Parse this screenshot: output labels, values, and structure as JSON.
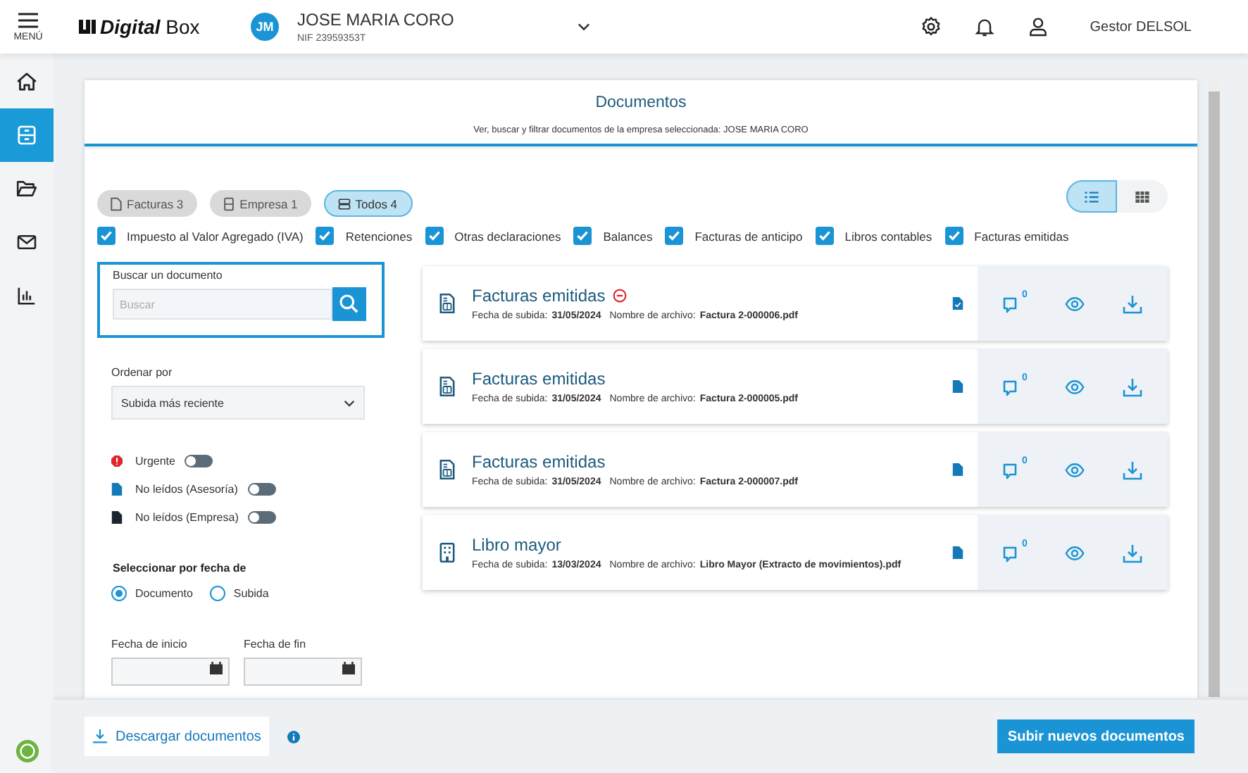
{
  "header": {
    "menu_label": "MENÚ",
    "logo": {
      "bold": "Digital",
      "regular": "Box"
    },
    "company": {
      "initials": "JM",
      "name": "JOSE MARIA CORO",
      "nif": "NIF 23959353T"
    },
    "user": "Gestor DELSOL"
  },
  "sidebar": {
    "items": [
      {
        "selected": false
      },
      {
        "selected": true
      },
      {
        "selected": false
      },
      {
        "selected": false
      },
      {
        "selected": false
      }
    ]
  },
  "page": {
    "title": "Documentos",
    "subtitle": "Ver, buscar y filtrar documentos de la empresa seleccionada: JOSE MARIA CORO"
  },
  "chips": [
    {
      "label": "Facturas 3",
      "selected": false
    },
    {
      "label": "Empresa 1",
      "selected": false
    },
    {
      "label": "Todos 4",
      "selected": true
    }
  ],
  "view_toggle": [
    {
      "selected": true
    },
    {
      "selected": false
    }
  ],
  "categories": [
    {
      "label": "Impuesto al Valor Agregado (IVA)",
      "checked": true
    },
    {
      "label": "Retenciones",
      "checked": true
    },
    {
      "label": "Otras declaraciones",
      "checked": true
    },
    {
      "label": "Balances",
      "checked": true
    },
    {
      "label": "Facturas de anticipo",
      "checked": true
    },
    {
      "label": "Libros contables",
      "checked": true
    },
    {
      "label": "Facturas emitidas",
      "checked": true
    }
  ],
  "search": {
    "label": "Buscar un documento",
    "placeholder": "Buscar"
  },
  "sort": {
    "label": "Ordenar por",
    "value": "Subida más reciente"
  },
  "toggles": [
    {
      "label": "Urgente",
      "color": "#e0262b",
      "on": false
    },
    {
      "label": "No leídos (Asesoría)",
      "color": "#1479b8",
      "on": false
    },
    {
      "label": "No leídos (Empresa)",
      "color": "#1b2530",
      "on": false
    }
  ],
  "date_filter": {
    "label": "Seleccionar por fecha de",
    "options": [
      {
        "label": "Documento",
        "selected": true
      },
      {
        "label": "Subida",
        "selected": false
      }
    ],
    "start_label": "Fecha de inicio",
    "end_label": "Fecha de fin"
  },
  "documents": [
    {
      "kind": "invoice",
      "title": "Facturas emitidas",
      "urgent": true,
      "date_label": "Fecha de subida:",
      "date": "31/05/2024",
      "file_label": "Nombre de archivo:",
      "file": "Factura 2-000006.pdf",
      "read": true,
      "comments": "0"
    },
    {
      "kind": "invoice",
      "title": "Facturas emitidas",
      "urgent": false,
      "date_label": "Fecha de subida:",
      "date": "31/05/2024",
      "file_label": "Nombre de archivo:",
      "file": "Factura 2-000005.pdf",
      "read": false,
      "comments": "0"
    },
    {
      "kind": "invoice",
      "title": "Facturas emitidas",
      "urgent": false,
      "date_label": "Fecha de subida:",
      "date": "31/05/2024",
      "file_label": "Nombre de archivo:",
      "file": "Factura 2-000007.pdf",
      "read": false,
      "comments": "0"
    },
    {
      "kind": "building",
      "title": "Libro mayor",
      "urgent": false,
      "date_label": "Fecha de subida:",
      "date": "13/03/2024",
      "file_label": "Nombre de archivo:",
      "file": "Libro Mayor (Extracto de movimientos).pdf",
      "read": false,
      "comments": "0"
    }
  ],
  "footer": {
    "download": "Descargar documentos",
    "upload": "Subir nuevos documentos"
  }
}
